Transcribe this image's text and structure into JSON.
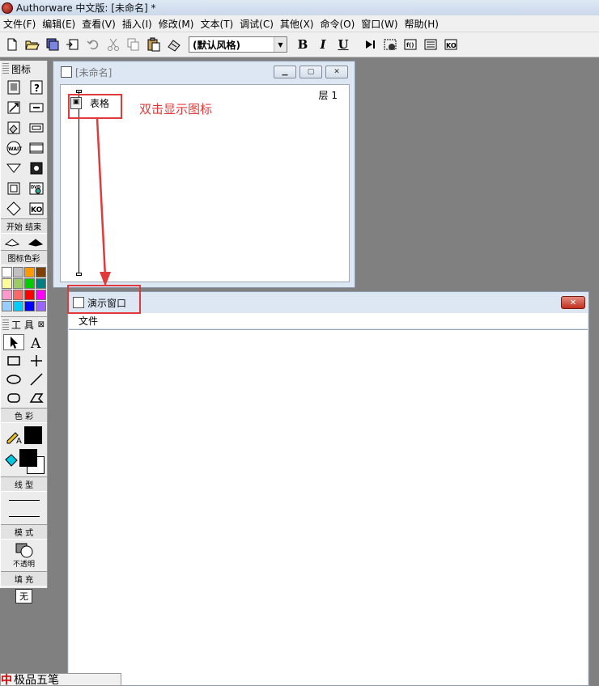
{
  "app": {
    "title": "Authorware 中文版: [未命名] *"
  },
  "menu": [
    "文件(F)",
    "编辑(E)",
    "查看(V)",
    "插入(I)",
    "修改(M)",
    "文本(T)",
    "调试(C)",
    "其他(X)",
    "命令(O)",
    "窗口(W)",
    "帮助(H)"
  ],
  "toolbar": {
    "style_value": "(默认风格)",
    "bold": "B",
    "italic": "I",
    "underline": "U"
  },
  "palette": {
    "title": "图标",
    "start_end_label": "开始 结束",
    "icon_color_label": "图标色彩",
    "swatches": [
      "#ffffff",
      "#c0c0c0",
      "#ff9900",
      "#804000",
      "#ffff99",
      "#99cc66",
      "#00cc00",
      "#008080",
      "#ff99cc",
      "#ff6666",
      "#ff0000",
      "#ff00ff",
      "#99ccff",
      "#00ccff",
      "#0000ff",
      "#9966ff"
    ]
  },
  "tools": {
    "title": "工 具",
    "color_label": "色 彩",
    "line_label": "线 型",
    "mode_label": "模 式",
    "mode_value": "不透明",
    "fill_label": "填 充",
    "fill_value": "无"
  },
  "design_window": {
    "title": "[未命名]",
    "layer": "层 1",
    "flow_item": "表格"
  },
  "annotation": {
    "text": "双击显示图标"
  },
  "presentation_window": {
    "title": "演示窗口",
    "menu_file": "文件"
  },
  "ime": {
    "logo": "中",
    "label": "极品五笔"
  }
}
